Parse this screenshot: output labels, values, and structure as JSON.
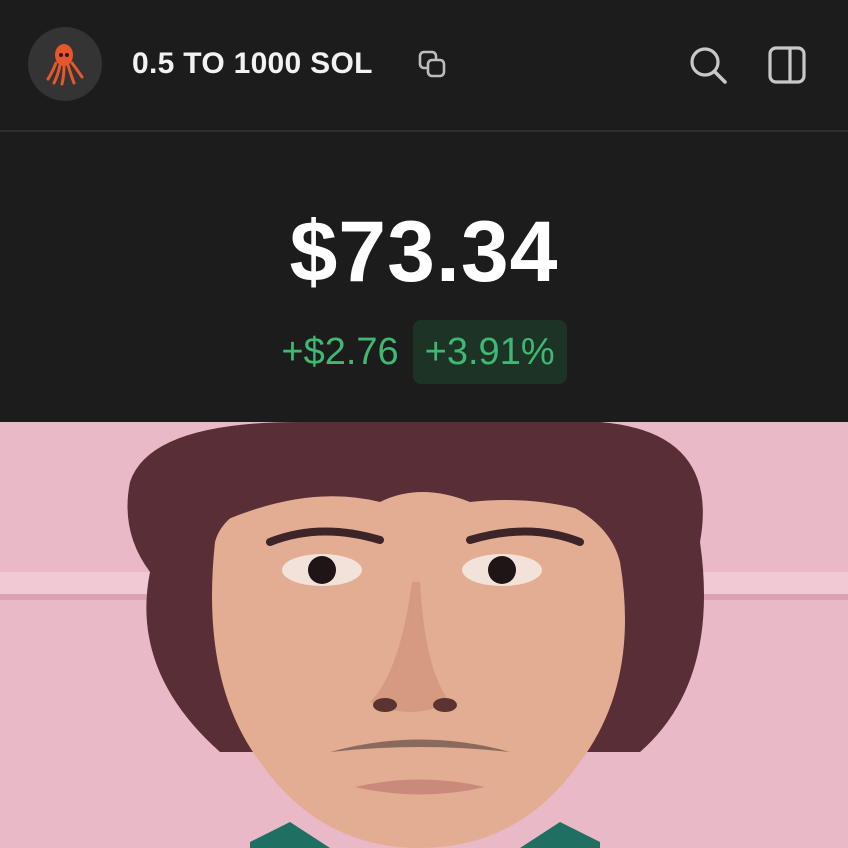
{
  "header": {
    "title": "0.5 TO 1000 SOL",
    "avatar_icon": "squid-icon",
    "copy_icon": "copy-icon",
    "search_icon": "search-icon",
    "panel_icon": "sidebar-panel-icon"
  },
  "price": {
    "value": "$73.34",
    "change_abs": "+$2.76",
    "change_pct": "+3.91%"
  },
  "colors": {
    "background": "#1c1c1c",
    "positive": "#3fb873",
    "positive_bg": "#1d3326",
    "photo_background": "#e9b9c8"
  }
}
